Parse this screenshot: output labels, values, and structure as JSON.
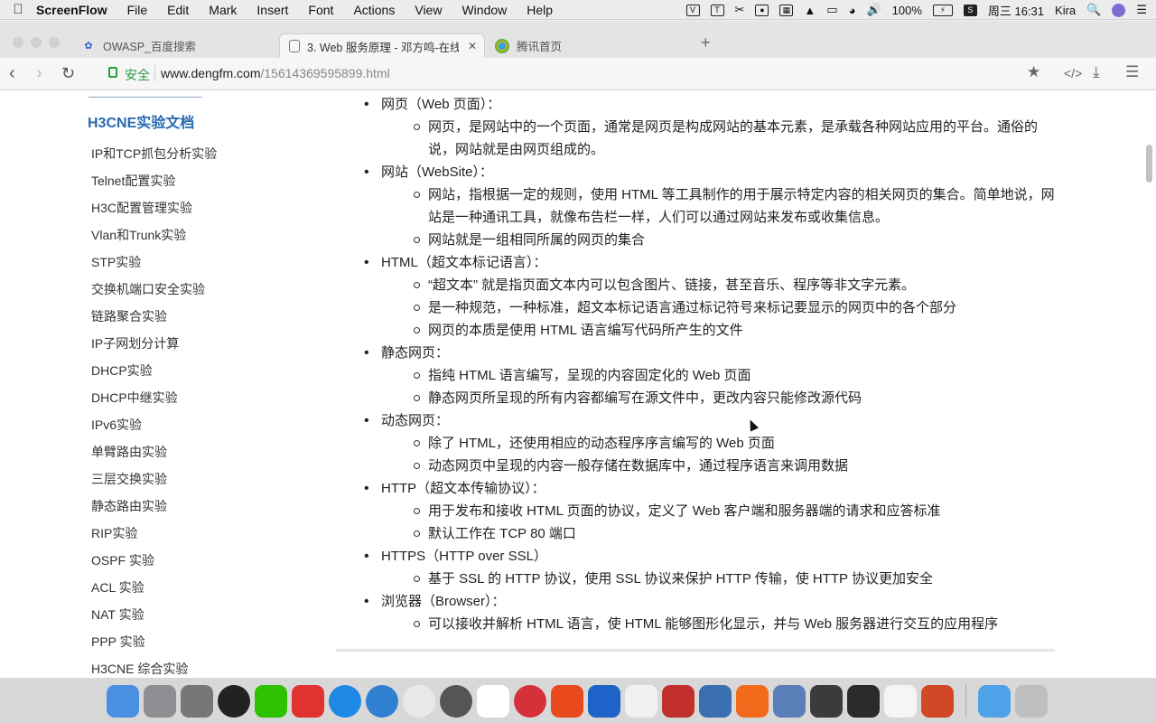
{
  "menubar": {
    "app_name": "ScreenFlow",
    "menus": [
      "File",
      "Edit",
      "Mark",
      "Insert",
      "Font",
      "Actions",
      "View",
      "Window",
      "Help"
    ],
    "status": {
      "battery": "100%",
      "day_time": "周三 16:31",
      "user": "Kira"
    }
  },
  "tabs": [
    {
      "title": "OWASP_百度搜索",
      "icon": "baidu-paw-icon"
    },
    {
      "title": "3. Web 服务原理 - 邓方鸣-在线",
      "icon": "document-icon"
    },
    {
      "title": "腾讯首页",
      "icon": "tencent-icon"
    }
  ],
  "address": {
    "secure_label": "安全",
    "domain": "www.dengfm.com",
    "path": "/15614369595899.html"
  },
  "sidebar": {
    "title": "H3CNE实验文档",
    "items": [
      "IP和TCP抓包分析实验",
      "Telnet配置实验",
      "H3C配置管理实验",
      "Vlan和Trunk实验",
      "STP实验",
      "交换机端口安全实验",
      "链路聚合实验",
      "IP子网划分计算",
      "DHCP实验",
      "DHCP中继实验",
      "IPv6实验",
      "单臂路由实验",
      "三层交换实验",
      "静态路由实验",
      "RIP实验",
      "OSPF 实验",
      "ACL 实验",
      "NAT 实验",
      "PPP 实验",
      "H3CNE 综合实验"
    ]
  },
  "content": {
    "sections": [
      {
        "title": "网页（Web 页面）：",
        "items": [
          "网页，是网站中的一个页面，通常是网页是构成网站的基本元素，是承载各种网站应用的平台。通俗的说，网站就是由网页组成的。"
        ]
      },
      {
        "title": "网站（WebSite）：",
        "items": [
          "网站，指根据一定的规则，使用 HTML 等工具制作的用于展示特定内容的相关网页的集合。简单地说，网站是一种通讯工具，就像布告栏一样，人们可以通过网站来发布或收集信息。",
          "网站就是一组相同所属的网页的集合"
        ]
      },
      {
        "title": "HTML（超文本标记语言）：",
        "items": [
          "“超文本” 就是指页面文本内可以包含图片、链接，甚至音乐、程序等非文字元素。",
          "是一种规范，一种标准，超文本标记语言通过标记符号来标记要显示的网页中的各个部分",
          "网页的本质是使用 HTML 语言编写代码所产生的文件"
        ]
      },
      {
        "title": "静态网页：",
        "items": [
          "指纯 HTML 语言编写，呈现的内容固定化的 Web 页面",
          "静态网页所呈现的所有内容都编写在源文件中，更改内容只能修改源代码"
        ]
      },
      {
        "title": "动态网页：",
        "items": [
          "除了 HTML，还使用相应的动态程序序言编写的 Web 页面",
          "动态网页中呈现的内容一般存储在数据库中，通过程序语言来调用数据"
        ]
      },
      {
        "title": "HTTP（超文本传输协议）：",
        "items": [
          "用于发布和接收 HTML 页面的协议，定义了 Web 客户端和服务器端的请求和应答标准",
          "默认工作在 TCP 80 端口"
        ]
      },
      {
        "title": "HTTPS（HTTP over SSL）",
        "items": [
          "基于 SSL 的 HTTP 协议，使用 SSL 协议来保护 HTTP 传输，使 HTTP 协议更加安全"
        ]
      },
      {
        "title": "浏览器（Browser）：",
        "items": [
          "可以接收并解析 HTML 语言，使 HTML 能够图形化显示，并与 Web 服务器进行交互的应用程序"
        ]
      }
    ]
  },
  "dock": {
    "apps": [
      {
        "name": "finder-icon",
        "color": "#4a90e2"
      },
      {
        "name": "launchpad-icon",
        "color": "#8e8e93"
      },
      {
        "name": "system-preferences-icon",
        "color": "#777777"
      },
      {
        "name": "qq-icon",
        "color": "#222222"
      },
      {
        "name": "wechat-icon",
        "color": "#2dc100"
      },
      {
        "name": "app-red-icon",
        "color": "#e0322f"
      },
      {
        "name": "safari-icon",
        "color": "#1e88e5"
      },
      {
        "name": "app-blue-round-icon",
        "color": "#2f80d1"
      },
      {
        "name": "chrome-icon",
        "color": "#e9e9e9"
      },
      {
        "name": "davinci-icon",
        "color": "#555555"
      },
      {
        "name": "app-cloud-icon",
        "color": "#ffffff"
      },
      {
        "name": "app-red-round-icon",
        "color": "#d6303a"
      },
      {
        "name": "app-v-icon",
        "color": "#e84a1d"
      },
      {
        "name": "app-fin-icon",
        "color": "#1e64c8"
      },
      {
        "name": "vs-icon",
        "color": "#f1f1f1"
      },
      {
        "name": "parallels-icon",
        "color": "#c2302b"
      },
      {
        "name": "app-cube-icon",
        "color": "#3a6fb0"
      },
      {
        "name": "app-slash-icon",
        "color": "#f26b1d"
      },
      {
        "name": "preview-icon",
        "color": "#5a7fb8"
      },
      {
        "name": "sublime-icon",
        "color": "#3b3b3b"
      },
      {
        "name": "terminal-icon",
        "color": "#2b2b2b"
      },
      {
        "name": "app-flower-icon",
        "color": "#f5f5f5"
      },
      {
        "name": "powerpoint-icon",
        "color": "#d24726"
      },
      {
        "name": "downloads-folder-icon",
        "color": "#4ea3e8"
      },
      {
        "name": "trash-icon",
        "color": "#bfbfbf"
      }
    ]
  }
}
